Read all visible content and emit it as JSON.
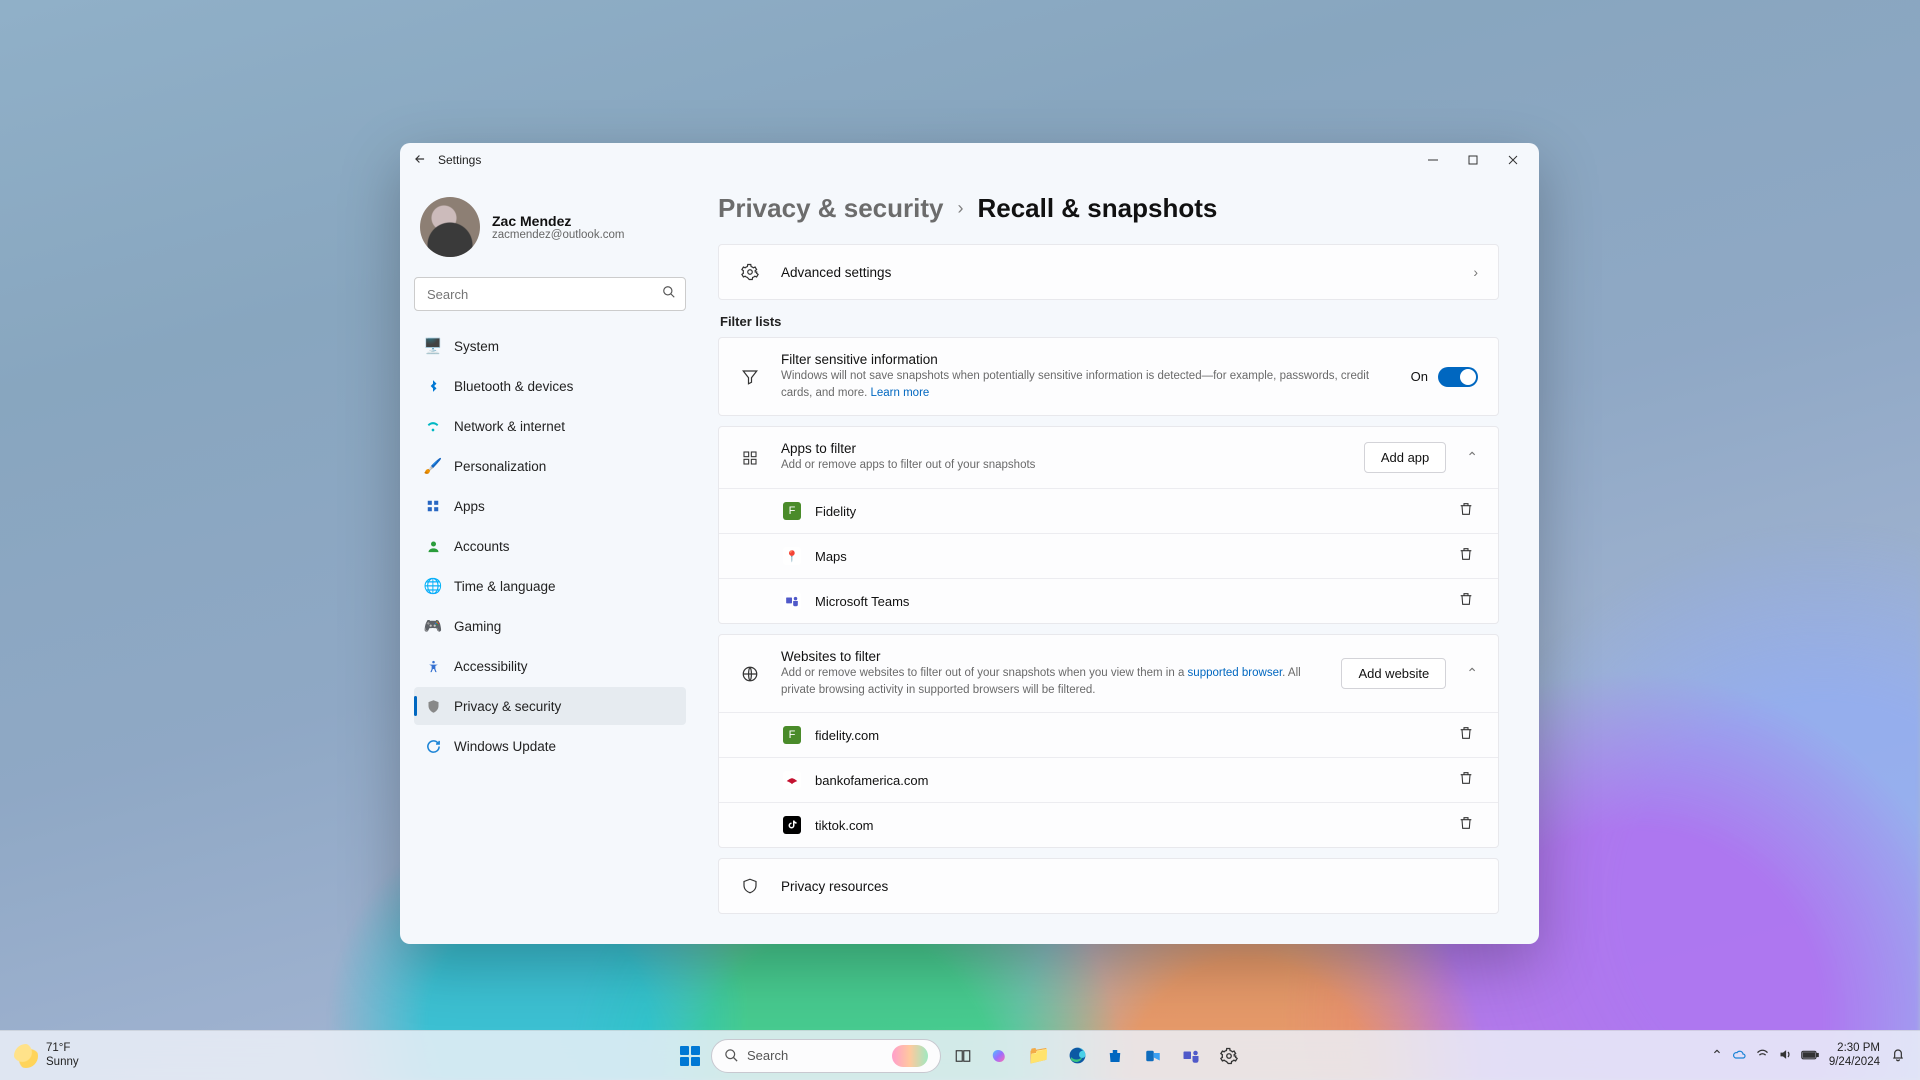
{
  "window": {
    "title": "Settings",
    "profile": {
      "name": "Zac Mendez",
      "email": "zacmendez@outlook.com"
    },
    "search_placeholder": "Search"
  },
  "nav": {
    "items": [
      {
        "label": "System"
      },
      {
        "label": "Bluetooth & devices"
      },
      {
        "label": "Network & internet"
      },
      {
        "label": "Personalization"
      },
      {
        "label": "Apps"
      },
      {
        "label": "Accounts"
      },
      {
        "label": "Time & language"
      },
      {
        "label": "Gaming"
      },
      {
        "label": "Accessibility"
      },
      {
        "label": "Privacy & security"
      },
      {
        "label": "Windows Update"
      }
    ],
    "active_index": 9
  },
  "breadcrumbs": {
    "parent": "Privacy & security",
    "current": "Recall & snapshots"
  },
  "adv": {
    "title": "Advanced settings"
  },
  "filter_lists_label": "Filter lists",
  "sensitive": {
    "title": "Filter sensitive information",
    "desc": "Windows will not save snapshots when potentially sensitive information is detected—for example, passwords, credit cards, and more. ",
    "learn_more": "Learn more",
    "state_label": "On",
    "on": true
  },
  "apps": {
    "title": "Apps to filter",
    "desc": "Add or remove apps to filter out of your snapshots",
    "add_label": "Add app",
    "items": [
      {
        "name": "Fidelity",
        "icon": "fidelity"
      },
      {
        "name": "Maps",
        "icon": "maps"
      },
      {
        "name": "Microsoft Teams",
        "icon": "teams"
      }
    ]
  },
  "websites": {
    "title": "Websites to filter",
    "desc_pre": "Add or remove websites to filter out of your snapshots when you view them in a ",
    "link": "supported browser",
    "desc_post": ". All private browsing activity in supported browsers will be filtered.",
    "add_label": "Add website",
    "items": [
      {
        "name": "fidelity.com",
        "icon": "fidelity"
      },
      {
        "name": "bankofamerica.com",
        "icon": "boa"
      },
      {
        "name": "tiktok.com",
        "icon": "tiktok"
      }
    ]
  },
  "privacy_resources": {
    "title": "Privacy resources"
  },
  "taskbar": {
    "weather": {
      "temp": "71°F",
      "cond": "Sunny"
    },
    "search_placeholder": "Search",
    "clock": {
      "time": "2:30 PM",
      "date": "9/24/2024"
    }
  }
}
